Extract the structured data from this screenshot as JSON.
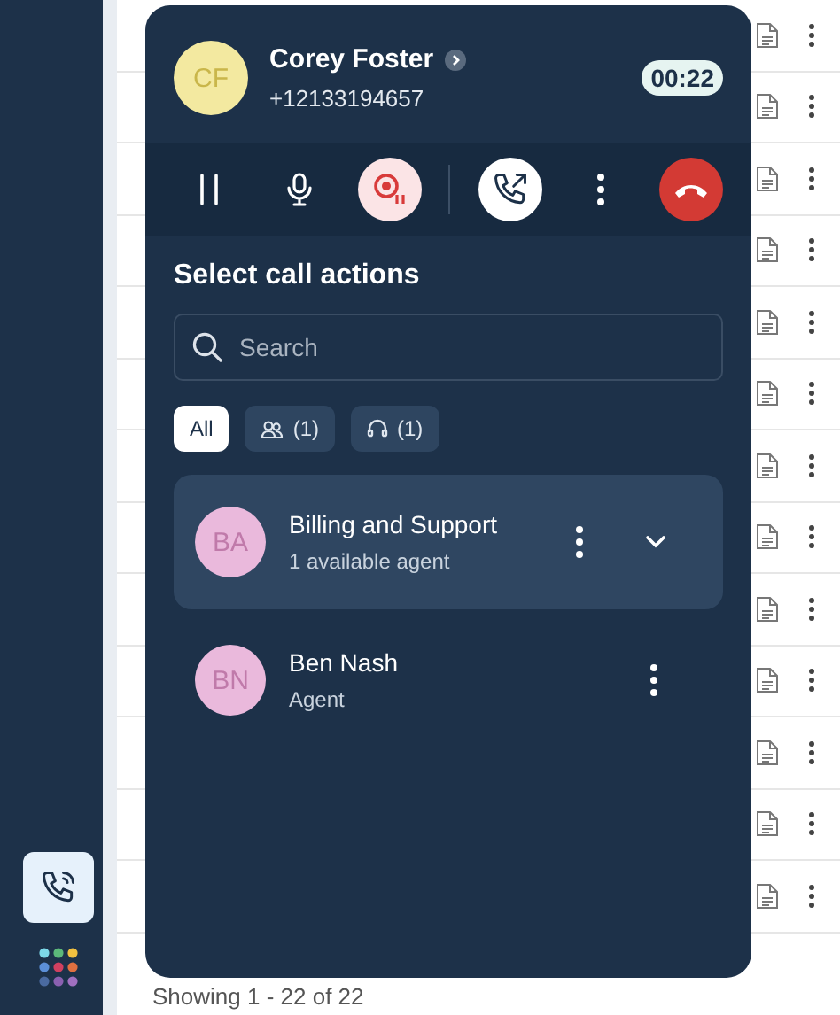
{
  "caller": {
    "initials": "CF",
    "name": "Corey Foster",
    "phone": "+12133194657",
    "timer": "00:22"
  },
  "controls": [
    {
      "kind": "hold"
    },
    {
      "kind": "mute"
    },
    {
      "kind": "record"
    },
    {
      "kind": "transfer"
    },
    {
      "kind": "more"
    },
    {
      "kind": "hangup"
    }
  ],
  "section_title": "Select call actions",
  "search": {
    "placeholder": "Search"
  },
  "filters": [
    {
      "kind": "all",
      "label": "All",
      "selected": true
    },
    {
      "kind": "teams",
      "label": "(1)",
      "selected": false
    },
    {
      "kind": "agents",
      "label": "(1)",
      "selected": false
    }
  ],
  "contacts": [
    {
      "kind": "team",
      "initials": "BA",
      "name": "Billing and Support",
      "subtitle": "1 available agent",
      "selected": true,
      "expanded": false
    },
    {
      "kind": "agent",
      "initials": "BN",
      "name": "Ben Nash",
      "subtitle": "Agent",
      "selected": false
    }
  ],
  "status_text": "Showing 1 - 22 of 22"
}
